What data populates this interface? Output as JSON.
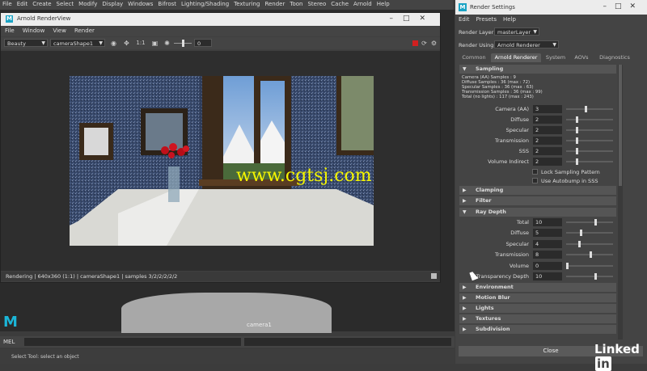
{
  "maya": {
    "menus": [
      "File",
      "Edit",
      "Create",
      "Select",
      "Modify",
      "Display",
      "Windows",
      "Bifrost",
      "Lighting/Shading",
      "Texturing",
      "Render",
      "Toon",
      "Stereo",
      "Cache",
      "Arnold",
      "Help"
    ],
    "viewport_camera_label": "camera1",
    "command_label": "MEL",
    "help_line": "Select Tool: select an object",
    "logo_letter": "M"
  },
  "render_view": {
    "title": "Arnold RenderView",
    "logo_letter": "M",
    "menus": [
      "File",
      "Window",
      "View",
      "Render"
    ],
    "toolbar": {
      "aov_select": "Beauty",
      "camera_select": "cameraShape1",
      "ratio_label": "1:1",
      "exposure_value": "0"
    },
    "status_text": "Rendering | 640x360 (1:1) | cameraShape1 | samples 3/2/2/2/2/2"
  },
  "render_settings": {
    "title": "Render Settings",
    "logo_letter": "M",
    "menus": [
      "Edit",
      "Presets",
      "Help"
    ],
    "render_layer_label": "Render Layer",
    "render_layer_value": "masterLayer",
    "render_using_label": "Render Using",
    "render_using_value": "Arnold Renderer",
    "tabs": [
      "Common",
      "Arnold Renderer",
      "System",
      "AOVs",
      "Diagnostics"
    ],
    "active_tab": "Arnold Renderer",
    "sampling": {
      "header": "Sampling",
      "stats": [
        "Camera (AA) Samples : 9",
        "Diffuse Samples : 36 (max : 72)",
        "Specular Samples : 36 (max : 63)",
        "Transmission Samples : 36 (max : 99)",
        "Total (no lights) : 117 (max : 243)"
      ],
      "params": [
        {
          "label": "Camera (AA)",
          "value": "3",
          "level": 0.4
        },
        {
          "label": "Diffuse",
          "value": "2",
          "level": 0.2
        },
        {
          "label": "Specular",
          "value": "2",
          "level": 0.2
        },
        {
          "label": "Transmission",
          "value": "2",
          "level": 0.2
        },
        {
          "label": "SSS",
          "value": "2",
          "level": 0.2
        },
        {
          "label": "Volume Indirect",
          "value": "2",
          "level": 0.2
        }
      ],
      "checkboxes": [
        "Lock Sampling Pattern",
        "Use Autobump in SSS"
      ]
    },
    "collapsed_1": [
      "Clamping",
      "Filter"
    ],
    "ray_depth": {
      "header": "Ray Depth",
      "params": [
        {
          "label": "Total",
          "value": "10",
          "level": 0.6
        },
        {
          "label": "Diffuse",
          "value": "5",
          "level": 0.3
        },
        {
          "label": "Specular",
          "value": "4",
          "level": 0.25
        },
        {
          "label": "Transmission",
          "value": "8",
          "level": 0.5
        },
        {
          "label": "Volume",
          "value": "0",
          "level": 0.0
        },
        {
          "label": "Transparency Depth",
          "value": "10",
          "level": 0.6
        }
      ]
    },
    "collapsed_2": [
      "Environment",
      "Motion Blur",
      "Lights",
      "Textures",
      "Subdivision"
    ],
    "close_label": "Close"
  },
  "watermark": "www.cgtsj.com",
  "brand": {
    "text": "Linked",
    "in": "in"
  },
  "colors": {
    "accent": "#1aa3c4",
    "watermark": "#f5f500"
  }
}
